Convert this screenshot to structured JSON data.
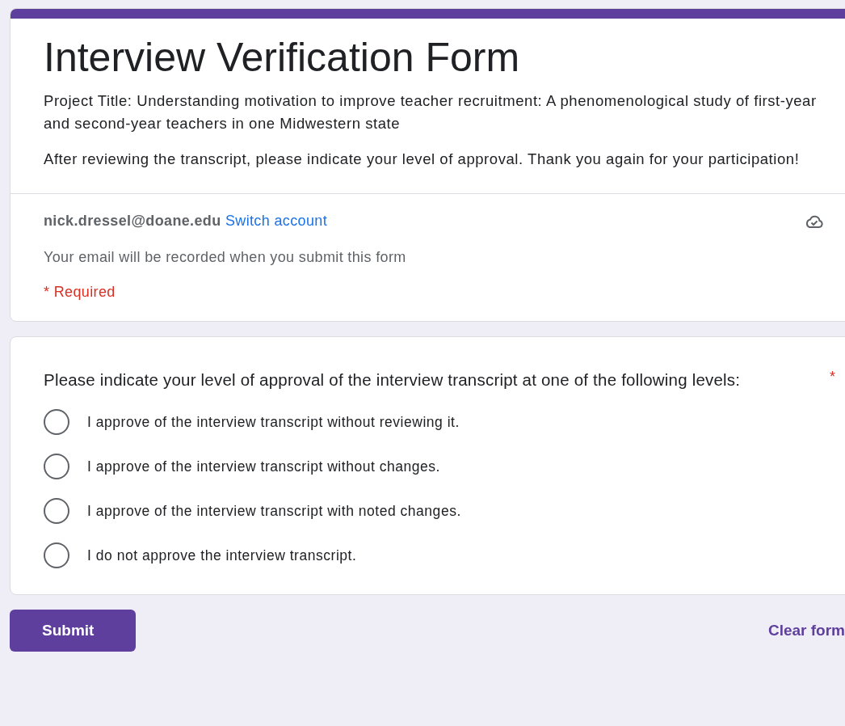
{
  "header": {
    "title": "Interview Verification Form",
    "description": [
      "Project Title: Understanding motivation to improve teacher recruitment: A phenomenological study of first-year and second-year teachers in one Midwestern state",
      "After reviewing the transcript, please indicate your level of approval. Thank you again for your participation!"
    ],
    "account": {
      "email": "nick.dressel@doane.edu",
      "switch_link": "Switch account"
    },
    "email_notice": "Your email will be recorded when you submit this form",
    "required_note": "* Required"
  },
  "question": {
    "text": "Please indicate your level of approval of the interview transcript at one of the following levels:",
    "required_mark": "*",
    "options": [
      {
        "label": "I approve of the interview transcript without reviewing it.",
        "selected": false
      },
      {
        "label": "I approve of the interview transcript without changes.",
        "selected": false
      },
      {
        "label": "I approve of the interview transcript with noted changes.",
        "selected": false
      },
      {
        "label": "I do not approve the interview transcript.",
        "selected": false
      }
    ]
  },
  "footer": {
    "submit": "Submit",
    "clear": "Clear form"
  }
}
